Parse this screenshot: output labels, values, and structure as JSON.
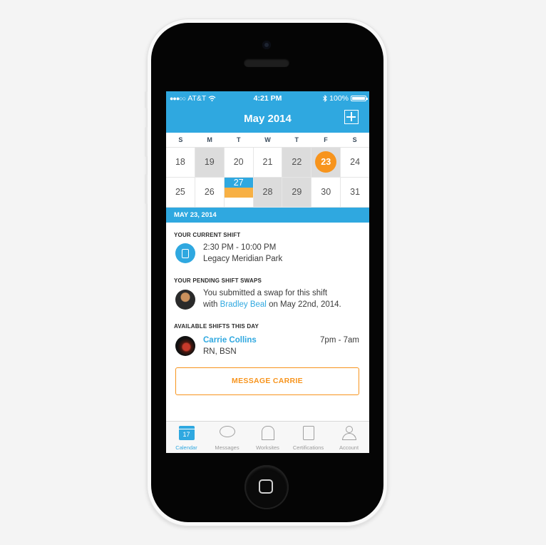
{
  "status_bar": {
    "carrier": "AT&T",
    "time": "4:21 PM",
    "battery": "100%",
    "signal": "●●●○○"
  },
  "header": {
    "title": "May 2014"
  },
  "calendar": {
    "weekdays": [
      "S",
      "M",
      "T",
      "W",
      "T",
      "F",
      "S"
    ],
    "week1": [
      "18",
      "19",
      "20",
      "21",
      "22",
      "23",
      "24"
    ],
    "week2": [
      "25",
      "26",
      "27",
      "28",
      "29",
      "30",
      "31"
    ]
  },
  "selected_date": "MAY 23, 2014",
  "current_shift": {
    "label": "YOUR CURRENT SHIFT",
    "time": "2:30 PM - 10:00 PM",
    "location": "Legacy Meridian Park"
  },
  "pending_swaps": {
    "label": "YOUR PENDING SHIFT SWAPS",
    "line1": "You submitted a swap for this shift",
    "line2_prefix": "with ",
    "person": "Bradley Beal",
    "line2_suffix": " on May 22nd, 2014."
  },
  "available": {
    "label": "AVAILABLE SHIFTS THIS DAY",
    "name": "Carrie Collins",
    "time": "7pm - 7am",
    "credentials": "RN, BSN",
    "button": "MESSAGE CARRIE"
  },
  "tabs": [
    {
      "label": "Calendar",
      "icon": "calendar-icon",
      "day": "17"
    },
    {
      "label": "Messages",
      "icon": "chat-bubble-icon"
    },
    {
      "label": "Worksites",
      "icon": "building-icon"
    },
    {
      "label": "Certifications",
      "icon": "certificate-icon"
    },
    {
      "label": "Account",
      "icon": "person-icon"
    }
  ],
  "colors": {
    "primary": "#2fa8e0",
    "accent": "#f7941d",
    "shaded_day": "#dcdcdc"
  }
}
